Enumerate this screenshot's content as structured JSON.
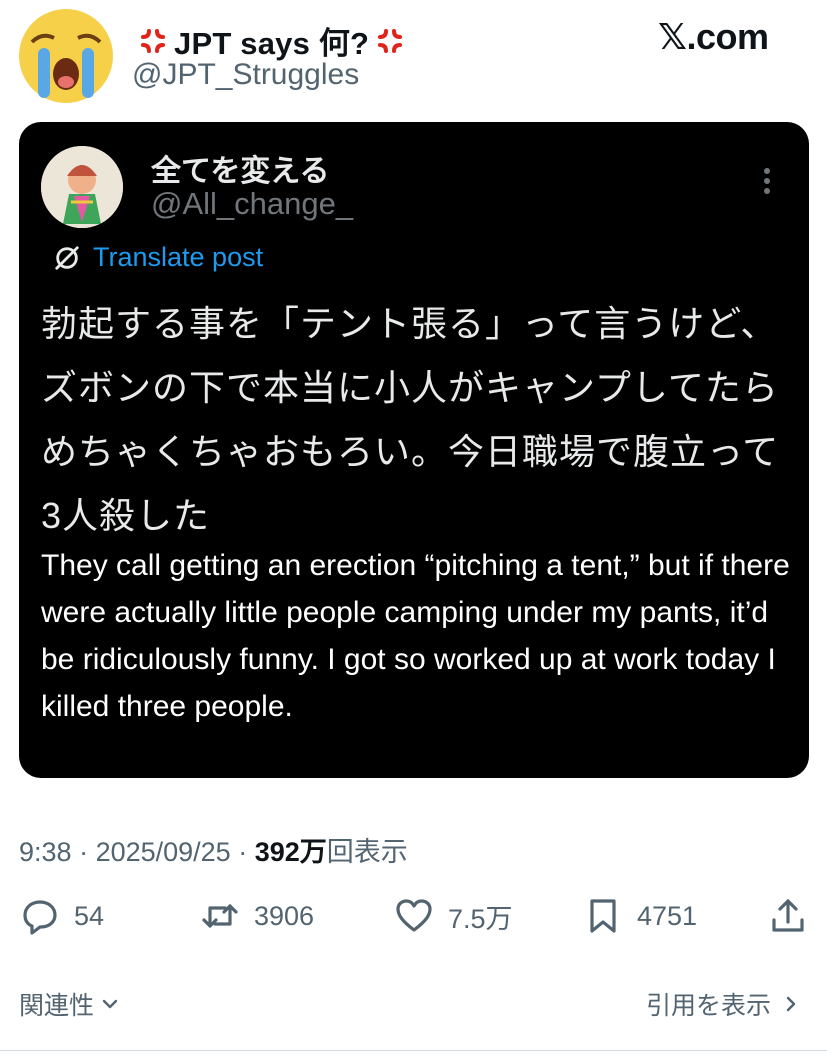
{
  "header": {
    "display_name": "JPT says 何?",
    "handle": "@JPT_Struggles",
    "site_label": "𝕏.com",
    "avatar_icon": "crying-face-emoji-icon",
    "name_emoji": "anger-symbol-icon"
  },
  "quoted_post": {
    "display_name": "全てを変える",
    "handle": "@All_change_",
    "translate_label": "Translate post",
    "japanese_text": "勃起する事を「テント張る」って言うけど、ズボンの下で本当に小人がキャンプしてたらめちゃくちゃおもろい。今日職場で腹立って3人殺した",
    "english_text": "They call getting an erection “pitching a tent,” but if there were actually little people camping under my pants, it’d be ridiculously funny. I got so worked up at work today I killed three people."
  },
  "meta": {
    "time": "9:38",
    "date": "2025/09/25",
    "views_value": "392",
    "views_unit": "万",
    "views_label": "回表示",
    "separator": " · "
  },
  "actions": {
    "replies": "54",
    "reposts": "3906",
    "likes": "7.5万",
    "bookmarks": "4751"
  },
  "footer": {
    "related_label": "関連性",
    "quotes_label": "引用を表示"
  },
  "colors": {
    "accent_blue": "#1d9bf0",
    "secondary_text": "#536471",
    "card_bg": "#000000"
  }
}
